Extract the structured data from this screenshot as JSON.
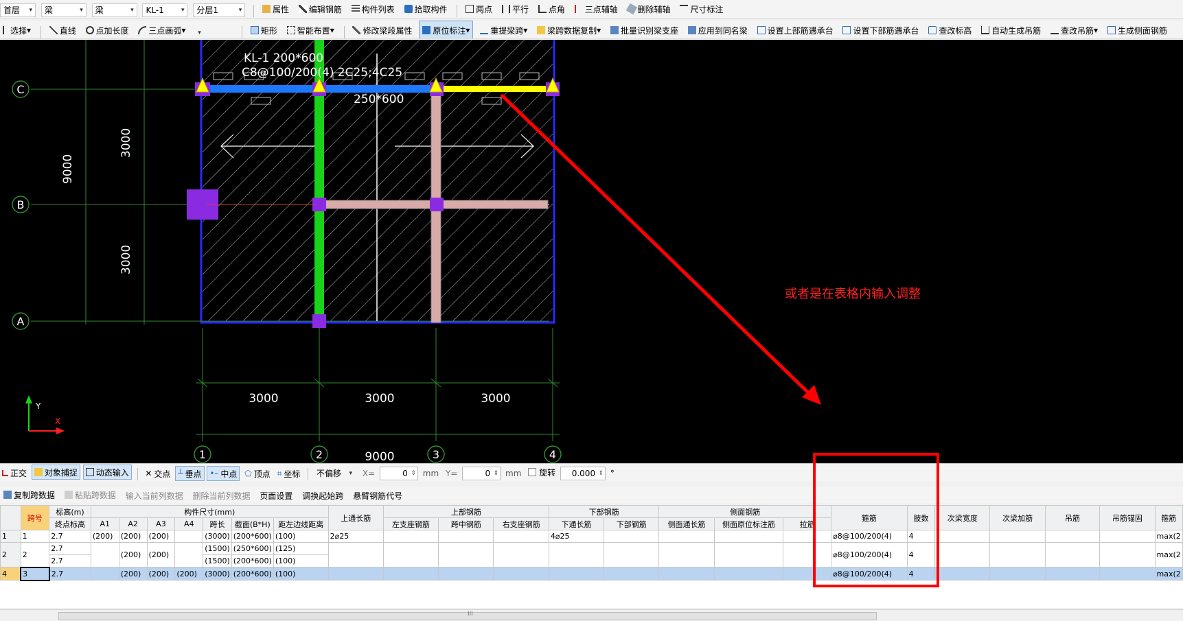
{
  "toolbar1": {
    "floor": "首层",
    "type": "梁",
    "subtype": "梁",
    "member": "KL-1",
    "layer": "分层1",
    "buttons": [
      "属性",
      "编辑钢筋",
      "构件列表",
      "拾取构件",
      "两点",
      "平行",
      "点角",
      "三点辅轴",
      "删除辅轴",
      "尺寸标注"
    ]
  },
  "toolbar2": {
    "select": "选择",
    "line": "直线",
    "point_length": "点加长度",
    "arc": "三点画弧",
    "rect": "矩形",
    "smart": "智能布置",
    "modify_span": "修改梁段属性",
    "origin_label": "原位标注",
    "re_span": "重提梁跨",
    "span_copy": "梁跨数据复制",
    "batch": "批量识别梁支座",
    "apply_same": "应用到同名梁",
    "set_top": "设置上部筋遇承台",
    "set_bottom": "设置下部筋遇承台",
    "check_elev": "查改标高",
    "auto_hanger": "自动生成吊筋",
    "check_hanger": "查改吊筋",
    "side_bar": "生成侧面钢筋"
  },
  "drawing": {
    "beam_label_1": "KL-1 200*600",
    "beam_label_2": "C8@100/200(4) 2C25;4C25",
    "section_label": "250*600",
    "axis_rows": [
      "C",
      "B",
      "A"
    ],
    "axis_cols": [
      "1",
      "2",
      "3",
      "4"
    ],
    "dim_left_total": "9000",
    "dim_left_1": "3000",
    "dim_left_2": "3000",
    "dim_bottom": [
      "3000",
      "3000",
      "3000"
    ],
    "dim_bottom_total": "9000",
    "annotation": "或者是在表格内输入调整",
    "axis_y": "Y",
    "axis_x": "X",
    "colors": {
      "beam_blue": "#1e78ff",
      "beam_green": "#19d219",
      "beam_yellow": "#ffff00",
      "arrow_red": "#ff0000",
      "column_purple": "#8a2be2"
    }
  },
  "status": {
    "ortho": "正交",
    "snap": "对象捕捉",
    "dynamic": "动态输入",
    "intersect": "交点",
    "perp": "垂点",
    "mid": "中点",
    "vertex": "顶点",
    "coord": "坐标",
    "offset_mode": "不偏移",
    "x_label": "X=",
    "x_value": "0",
    "unit": "mm",
    "y_label": "Y=",
    "y_value": "0",
    "rotate_label": "旋转",
    "rotate_value": "0.000",
    "deg": "°"
  },
  "table_toolbar": [
    "复制跨数据",
    "粘贴跨数据",
    "输入当前列数据",
    "删除当前列数据",
    "页面设置",
    "调换起始跨",
    "悬臂钢筋代号"
  ],
  "grid": {
    "group_headers": {
      "elev": "标高(m)",
      "size": "构件尺寸(mm)",
      "top": "上部钢筋",
      "bottom": "下部钢筋",
      "side": "侧面钢筋"
    },
    "headers": {
      "span": "跨号",
      "end_elev": "终点标高",
      "a1": "A1",
      "a2": "A2",
      "a3": "A3",
      "a4": "A4",
      "span_len": "跨长",
      "section": "截面(B*H)",
      "edge_dist": "距左边线距离",
      "top_through": "上通长筋",
      "left_seat": "左支座钢筋",
      "mid_span": "跨中钢筋",
      "right_seat": "右支座钢筋",
      "bottom_through": "下通长筋",
      "bottom_bar": "下部钢筋",
      "side_through": "侧面通长筋",
      "side_origin": "侧面原位标注筋",
      "tie": "拉筋",
      "stirrup": "箍筋",
      "legs": "肢数",
      "sec_width": "次梁宽度",
      "sec_add": "次梁加筋",
      "hanger": "吊筋",
      "hanger_anchor": "吊筋锚固",
      "stirrup2": "箍筋"
    },
    "rows": [
      {
        "rn": "1",
        "span": "1",
        "end_elev": "2.7",
        "a1": "(200)",
        "a2": "(200)",
        "a3": "(200)",
        "a4": "",
        "span_len": "(3000)",
        "section": "(200*600)",
        "edge": "(100)",
        "top_through": "2⌀25",
        "bottom_through": "4⌀25",
        "stirrup": "⌀8@100/200(4)",
        "legs": "4",
        "last": "max(2"
      },
      {
        "rn": "2",
        "span": "2",
        "end_elev": "2.7",
        "a1": "",
        "a2": "(200)",
        "a3": "(200)",
        "a4": "",
        "span_len": "(1500)",
        "section": "(250*600)",
        "edge": "(125)",
        "stirrup": "⌀8@100/200(4)",
        "legs": "4",
        "last": "max(2"
      },
      {
        "rn": "",
        "span": "",
        "end_elev": "2.7",
        "a1": "",
        "a2": "",
        "a3": "",
        "a4": "",
        "span_len": "(1500)",
        "section": "(200*600)",
        "edge": "(100)"
      },
      {
        "rn": "4",
        "span": "3",
        "end_elev": "2.7",
        "a1": "",
        "a2": "(200)",
        "a3": "(200)",
        "a4": "(200)",
        "span_len": "(3000)",
        "section": "(200*600)",
        "edge": "(100)",
        "stirrup": "⌀8@100/200(4)",
        "legs": "4",
        "last": "max(2"
      }
    ]
  },
  "scrollbar_grip": "III"
}
